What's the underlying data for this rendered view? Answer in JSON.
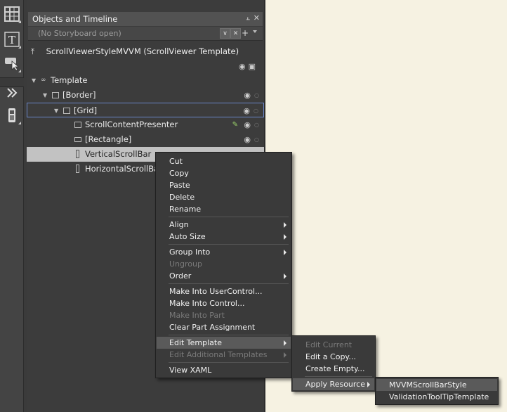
{
  "panel": {
    "title": "Objects and Timeline",
    "storyboard": "(No Storyboard open)",
    "scope_title": "ScrollViewerStyleMVVM (ScrollViewer Template)"
  },
  "tree": [
    {
      "label": "Template"
    },
    {
      "label": "[Border]"
    },
    {
      "label": "[Grid]"
    },
    {
      "label": "ScrollContentPresenter"
    },
    {
      "label": "[Rectangle]"
    },
    {
      "label": "VerticalScrollBar"
    },
    {
      "label": "HorizontalScrollBar"
    }
  ],
  "context_menu": {
    "items": [
      "Cut",
      "Copy",
      "Paste",
      "Delete",
      "Rename",
      "Align",
      "Auto Size",
      "Group Into",
      "Ungroup",
      "Order",
      "Make Into UserControl...",
      "Make Into Control...",
      "Make Into Part",
      "Clear Part Assignment",
      "Edit Template",
      "Edit Additional Templates",
      "View XAML"
    ]
  },
  "edit_template_menu": {
    "items": [
      "Edit Current",
      "Edit a Copy...",
      "Create Empty...",
      "Apply Resource"
    ]
  },
  "apply_resource_menu": {
    "items": [
      "MVVMScrollBarStyle",
      "ValidationToolTipTemplate"
    ]
  },
  "colors": {
    "canvas_bg": "#f6f2e2",
    "panel_bg": "#3c3c3c",
    "menu_bg": "#3a3a3a",
    "selection_outline": "#6a86c8"
  }
}
